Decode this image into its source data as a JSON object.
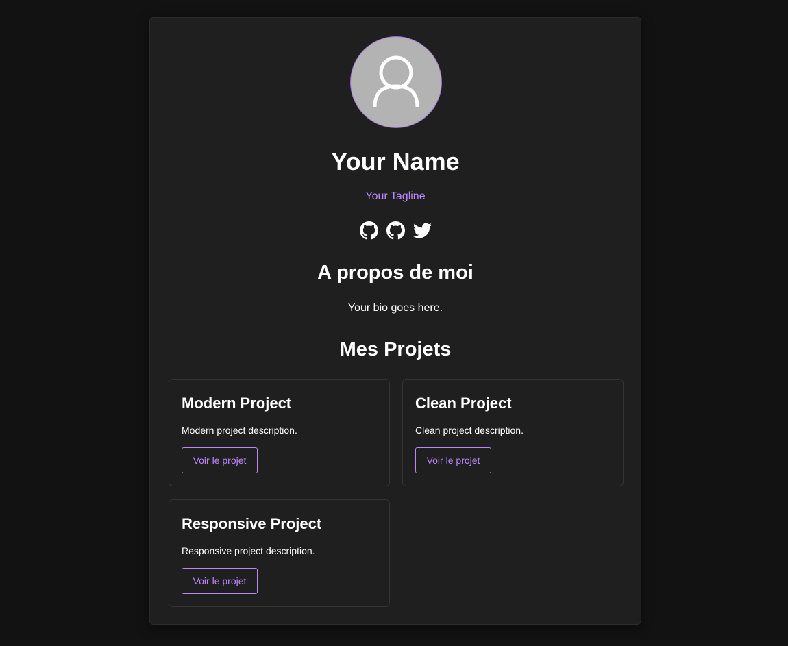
{
  "profile": {
    "name": "Your Name",
    "tagline": "Your Tagline",
    "avatar_icon": "user-silhouette-icon"
  },
  "social_links": [
    {
      "icon": "github-icon"
    },
    {
      "icon": "github-icon"
    },
    {
      "icon": "twitter-icon"
    }
  ],
  "about": {
    "title": "A propos de moi",
    "bio": "Your bio goes here."
  },
  "projects": {
    "title": "Mes Projets",
    "items": [
      {
        "title": "Modern Project",
        "description": "Modern project description.",
        "button_label": "Voir le projet"
      },
      {
        "title": "Clean Project",
        "description": "Clean project description.",
        "button_label": "Voir le projet"
      },
      {
        "title": "Responsive Project",
        "description": "Responsive project description.",
        "button_label": "Voir le projet"
      }
    ]
  },
  "colors": {
    "page_background": "#121212",
    "card_background": "#1f1f1f",
    "accent": "#bb86fc",
    "text": "#ffffff",
    "avatar_background": "#b3b3b3"
  }
}
